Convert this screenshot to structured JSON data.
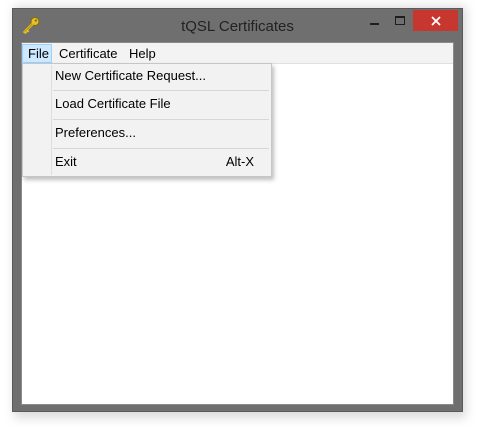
{
  "window": {
    "title": "tQSL Certificates",
    "controls": {
      "minimize": "minimize-icon",
      "maximize": "maximize-icon",
      "close": "close-icon",
      "close_color": "#c7372f"
    },
    "app_icon": "key-icon"
  },
  "menubar": {
    "items": [
      {
        "label": "File"
      },
      {
        "label": "Certificate"
      },
      {
        "label": "Help"
      }
    ],
    "active_highlight": "#cde8ff"
  },
  "file_menu": {
    "items": [
      {
        "label": "New Certificate Request..."
      },
      {
        "label": "Load Certificate File"
      },
      {
        "label": "Preferences..."
      },
      {
        "label": "Exit",
        "accelerator": "Alt-X"
      }
    ]
  }
}
